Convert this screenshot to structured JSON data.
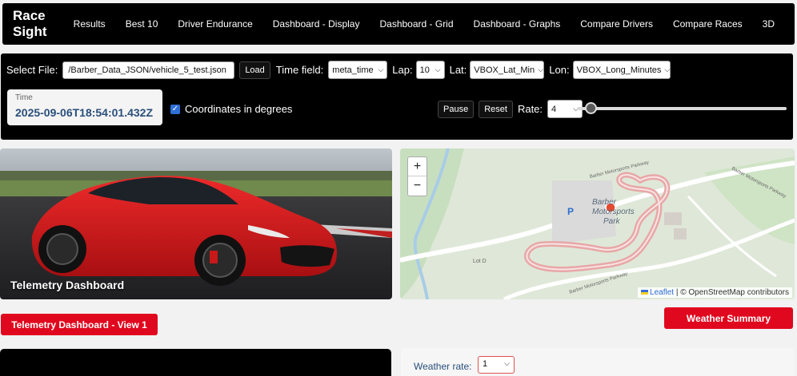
{
  "nav": {
    "brand": "Race Sight",
    "items": [
      "Results",
      "Best 10",
      "Driver Endurance",
      "Dashboard - Display",
      "Dashboard - Grid",
      "Dashboard - Graphs",
      "Compare Drivers",
      "Compare Races",
      "3D"
    ]
  },
  "controls": {
    "select_file_label": "Select File:",
    "file_value": "/Barber_Data_JSON/vehicle_5_test.json",
    "load_label": "Load",
    "time_field_label": "Time field:",
    "time_field_value": "meta_time",
    "lap_label": "Lap:",
    "lap_value": "10",
    "lat_label": "Lat:",
    "lat_value": "VBOX_Lat_Min",
    "lon_label": "Lon:",
    "lon_value": "VBOX_Long_Minutes",
    "time_label": "Time",
    "time_value": "2025-09-06T18:54:01.432Z",
    "coords_label": "Coordinates in degrees",
    "coords_checked": true,
    "pause_label": "Pause",
    "reset_label": "Reset",
    "rate_label": "Rate:",
    "rate_value": "4",
    "slider_fraction": 0.02
  },
  "hero": {
    "title": "Telemetry Dashboard"
  },
  "map": {
    "zoom_in": "+",
    "zoom_out": "−",
    "leaflet_label": "Leaflet",
    "attribution": "| © OpenStreetMap contributors",
    "park_label_1": "Barber",
    "park_label_2": "Motorsports",
    "park_label_3": "Park",
    "parking_label": "P",
    "road_label_1": "Barber Motorsports Parkway",
    "road_label_2": "Barber Motorsports Parkway",
    "road_label_3": "Barber Motorsports Parkway",
    "lot_label": "Lot D"
  },
  "buttons": {
    "view1": "Telemetry Dashboard - View 1",
    "weather": "Weather Summary"
  },
  "weather": {
    "rate_label": "Weather rate:",
    "rate_value": "1"
  },
  "colors": {
    "accent_red": "#e0081e",
    "time_blue": "#2a4f7a",
    "car_red": "#d81c1c"
  }
}
